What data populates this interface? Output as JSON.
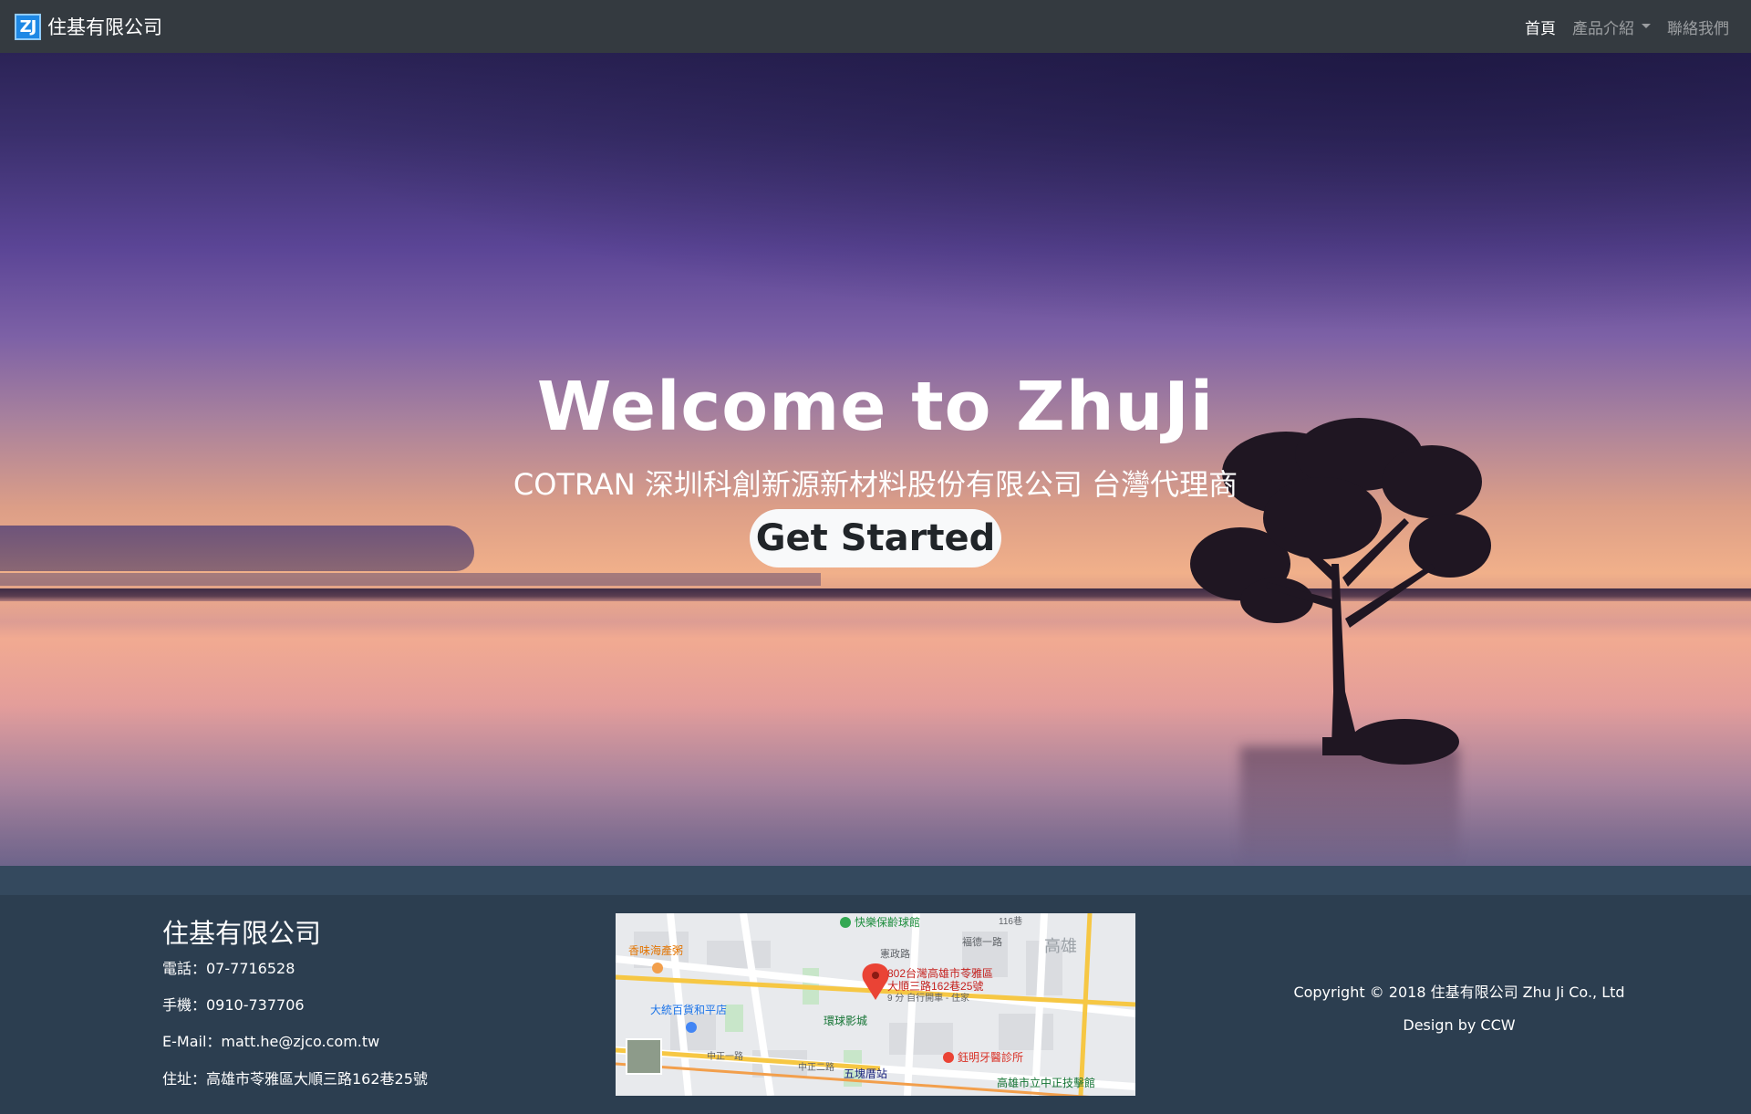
{
  "nav": {
    "logo_text": "ZJ",
    "brand": "住基有限公司",
    "links": [
      {
        "label": "首頁",
        "active": true
      },
      {
        "label": "產品介紹",
        "dropdown": true
      },
      {
        "label": "聯絡我們"
      }
    ]
  },
  "hero": {
    "title": "Welcome to ZhuJi",
    "subtitle": "COTRAN 深圳科創新源新材料股份有限公司 台灣代理商",
    "cta": "Get Started"
  },
  "footer": {
    "company": "住基有限公司",
    "phone": "電話：07-7716528",
    "mobile": "手機：0910-737706",
    "email": "E-Mail：matt.he@zjco.com.tw",
    "address": "住址：高雄市苓雅區大順三路162巷25號",
    "copyright": "Copyright © 2018 住基有限公司 Zhu Ji Co., Ltd",
    "design": "Design by CCW"
  },
  "map": {
    "pin_label_1": "802台灣高雄市苓雅區",
    "pin_label_2": "大順三路162巷25號",
    "pin_sub": "9 分 自行開車 - 住家",
    "places": [
      "快樂保齡球館",
      "香味海產粥",
      "大統百貨和平店",
      "環球影城",
      "鈺明牙醫診所",
      "高雄市立中正技擊館",
      "高雄",
      "五塊厝站",
      "中正一路",
      "中正二路",
      "褔德一路",
      "憲政路",
      "116巷"
    ]
  }
}
